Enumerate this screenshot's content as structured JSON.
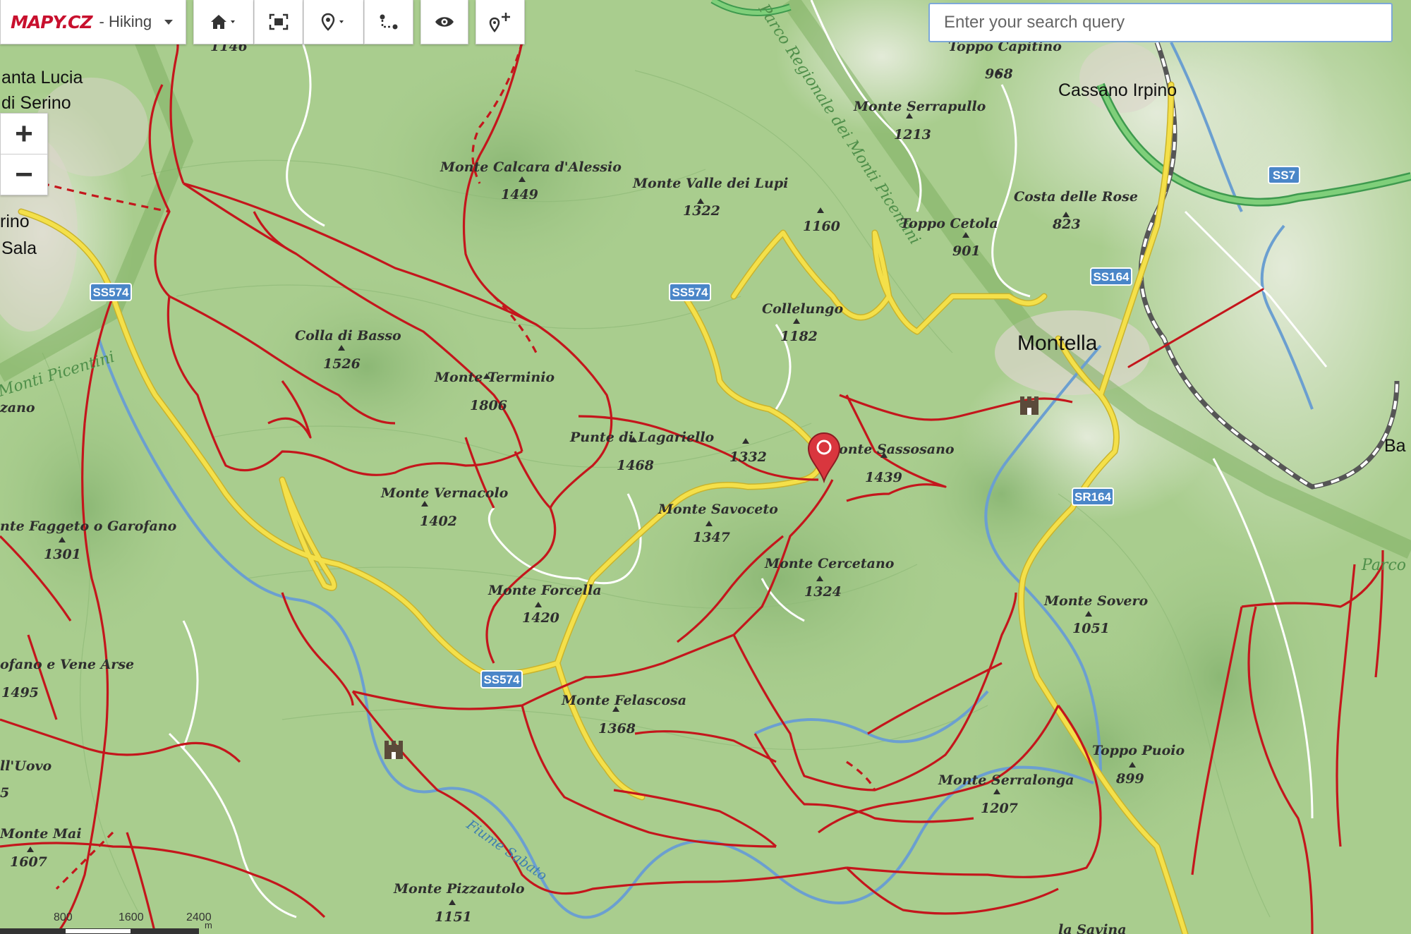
{
  "app": {
    "logo": "MAPY.CZ",
    "mode": "- Hiking",
    "search_placeholder": "Enter your search query"
  },
  "toolbar": {
    "buttons": [
      {
        "icon": "home-icon",
        "has_dropdown": true
      },
      {
        "icon": "fit-view-icon",
        "has_dropdown": false
      },
      {
        "icon": "location-icon",
        "has_dropdown": true
      },
      {
        "icon": "route-icon",
        "has_dropdown": false
      },
      {
        "icon": "eye-icon",
        "has_dropdown": false
      },
      {
        "icon": "add-pin-icon",
        "has_dropdown": false
      }
    ]
  },
  "zoom": {
    "in": "+",
    "out": "−"
  },
  "scale": {
    "labels": [
      "800",
      "1600",
      "2400",
      "m"
    ]
  },
  "colors": {
    "terrain": "#a9cd8e",
    "trail": "#c4161c",
    "road_yellow": "#f2dc3c",
    "road_green": "#4cb25a",
    "shield": "#4a86c8",
    "marker": "#d9363e",
    "river": "#6b9fd0",
    "park_band": "#7fb062"
  },
  "towns": {
    "santa_lucia_1": "anta Lucia",
    "santa_lucia_2": "di Serino",
    "serino": "rino",
    "sala": "Sala",
    "cassano": "Cassano Irpino",
    "montella": "Montella",
    "ba": "Ba"
  },
  "peaks": {
    "p1146": "1146",
    "calcara": {
      "name": "Monte Calcara d'Alessio",
      "elev": "1449"
    },
    "valle_lupi": {
      "name": "Monte Valle dei Lupi",
      "elev": "1322"
    },
    "p1160": "1160",
    "toppo_capitino": {
      "name": "Toppo Capitino",
      "elev": "968"
    },
    "serrapullo": {
      "name": "Monte Serrapullo",
      "elev": "1213"
    },
    "costa_rose": {
      "name": "Costa delle Rose",
      "elev": "823"
    },
    "toppo_cetola": {
      "name": "Toppo Cetola",
      "elev": "901"
    },
    "collelungo": {
      "name": "Collelungo",
      "elev": "1182"
    },
    "colla_basso": {
      "name": "Colla di Basso",
      "elev": "1526"
    },
    "terminio": {
      "name": "Monte Terminio",
      "elev": "1806"
    },
    "lagariello": {
      "name": "Punte di Lagariello",
      "elev": "1468"
    },
    "p1332": "1332",
    "sassosano": {
      "name": "Monte Sassosano",
      "elev": "1439"
    },
    "vernacolo": {
      "name": "Monte Vernacolo",
      "elev": "1402"
    },
    "savoceto": {
      "name": "Monte Savoceto",
      "elev": "1347"
    },
    "faggeto": {
      "name": "nte Faggeto o Garofano",
      "elev": "1301"
    },
    "cercetano": {
      "name": "Monte Cercetano",
      "elev": "1324"
    },
    "forcella": {
      "name": "Monte Forcella",
      "elev": "1420"
    },
    "sovero": {
      "name": "Monte Sovero",
      "elev": "1051"
    },
    "vene_arse": {
      "name": "ofano e Vene Arse",
      "elev": "1495"
    },
    "felascosa": {
      "name": "Monte Felascosa",
      "elev": "1368"
    },
    "toppo_puoio": {
      "name": "Toppo Puoio",
      "elev": "899"
    },
    "uovo": {
      "name": "ll'Uovo",
      "elev": "5"
    },
    "serralonga": {
      "name": "Monte Serralonga",
      "elev": "1207"
    },
    "mai": {
      "name": "Monte Mai",
      "elev": "1607"
    },
    "pizzautolo": {
      "name": "Monte Pizzautolo",
      "elev": "1151"
    },
    "la_savina": {
      "name": "la Savina"
    },
    "zano": {
      "name": "zano"
    }
  },
  "roads": {
    "ss574_a": "SS574",
    "ss574_b": "SS574",
    "ss574_c": "SS574",
    "ss164": "SS164",
    "ss7": "SS7",
    "sr164": "SR164"
  },
  "areas": {
    "park_regional": "Parco Regionale dei Monti Picentini",
    "monti_picentini": "Monti Picentini",
    "parco_right": "Parco",
    "river_sabato": "Fiume Sabato"
  }
}
